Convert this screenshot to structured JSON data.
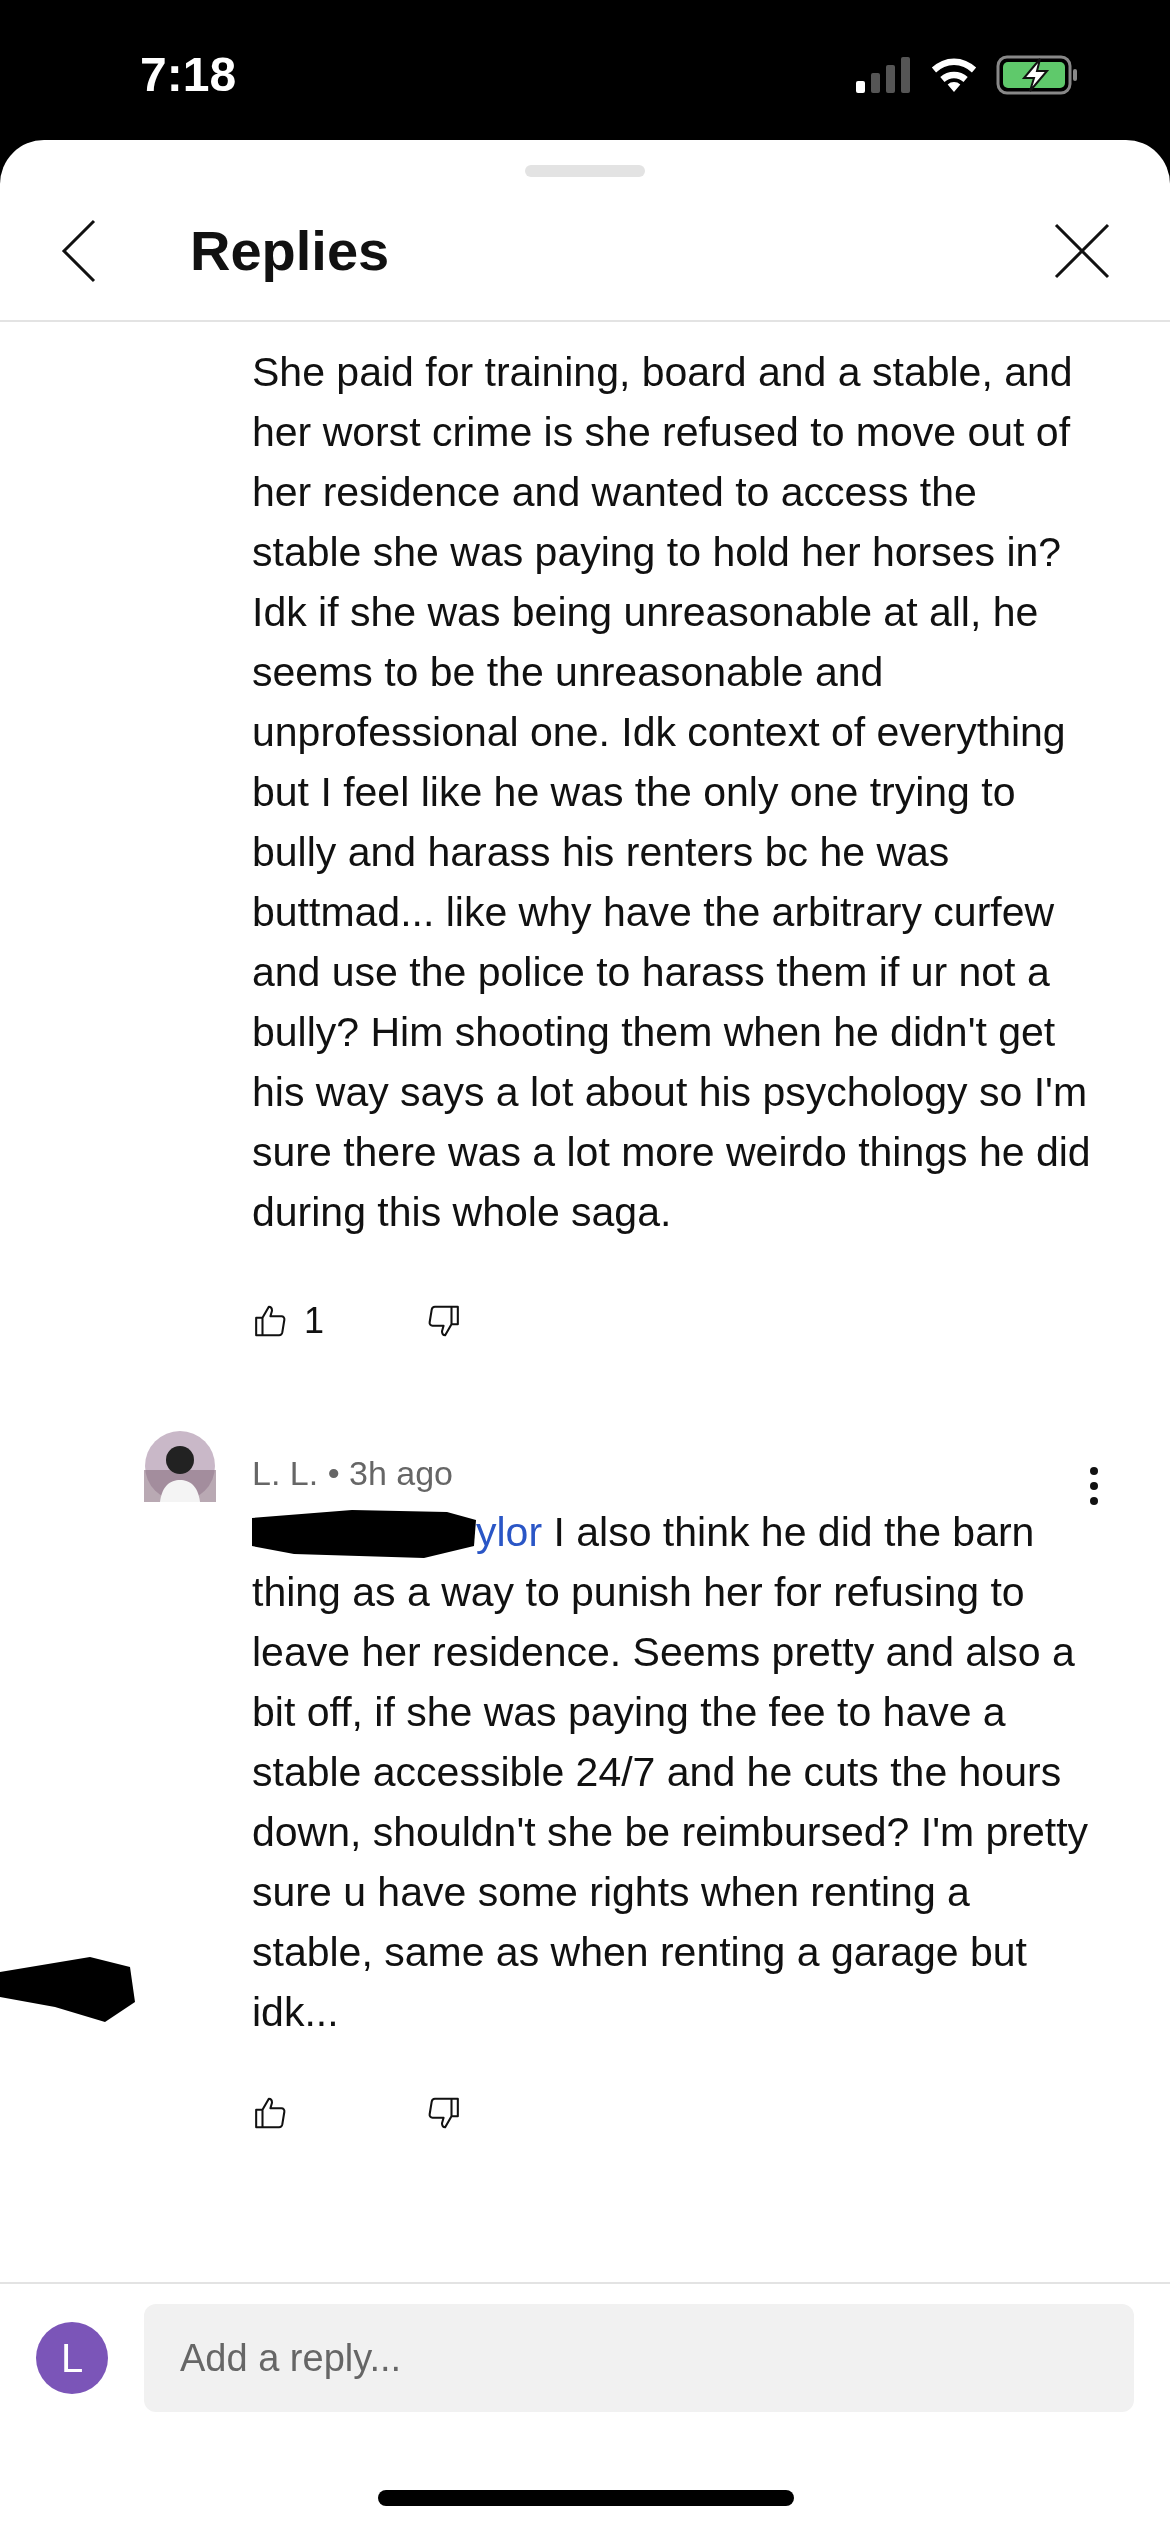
{
  "status_bar": {
    "time": "7:18"
  },
  "header": {
    "title": "Replies"
  },
  "comments": [
    {
      "text": "She paid for training, board and a stable, and her worst crime is she refused to move out of her residence and wanted to access the stable she was paying to hold her horses in? Idk if she was being unreasonable at all, he seems to be the unreasonable and unprofessional one. Idk context of everything but I feel like he was the only one trying to bully and harass his renters bc he was buttmad... like why have the arbitrary curfew and use the police to harass them if ur not a bully? Him shooting them when he didn't get his way says a lot about his psychology so I'm sure there was a lot more weirdo things he did during this whole saga.",
      "likes": "1"
    },
    {
      "author": "L. L.",
      "separator": "•",
      "time": "3h ago",
      "mention": "ylor",
      "text": "I also think he did the barn thing as a way to punish her for refusing to leave her residence. Seems pretty and also a bit off, if she was paying the fee to have a stable accessible 24/7 and he cuts the hours down, shouldn't she be reimbursed? I'm pretty sure u have some rights when renting a stable, same as when renting a garage but idk..."
    }
  ],
  "reply_bar": {
    "avatar_letter": "L",
    "placeholder": "Add a reply..."
  }
}
